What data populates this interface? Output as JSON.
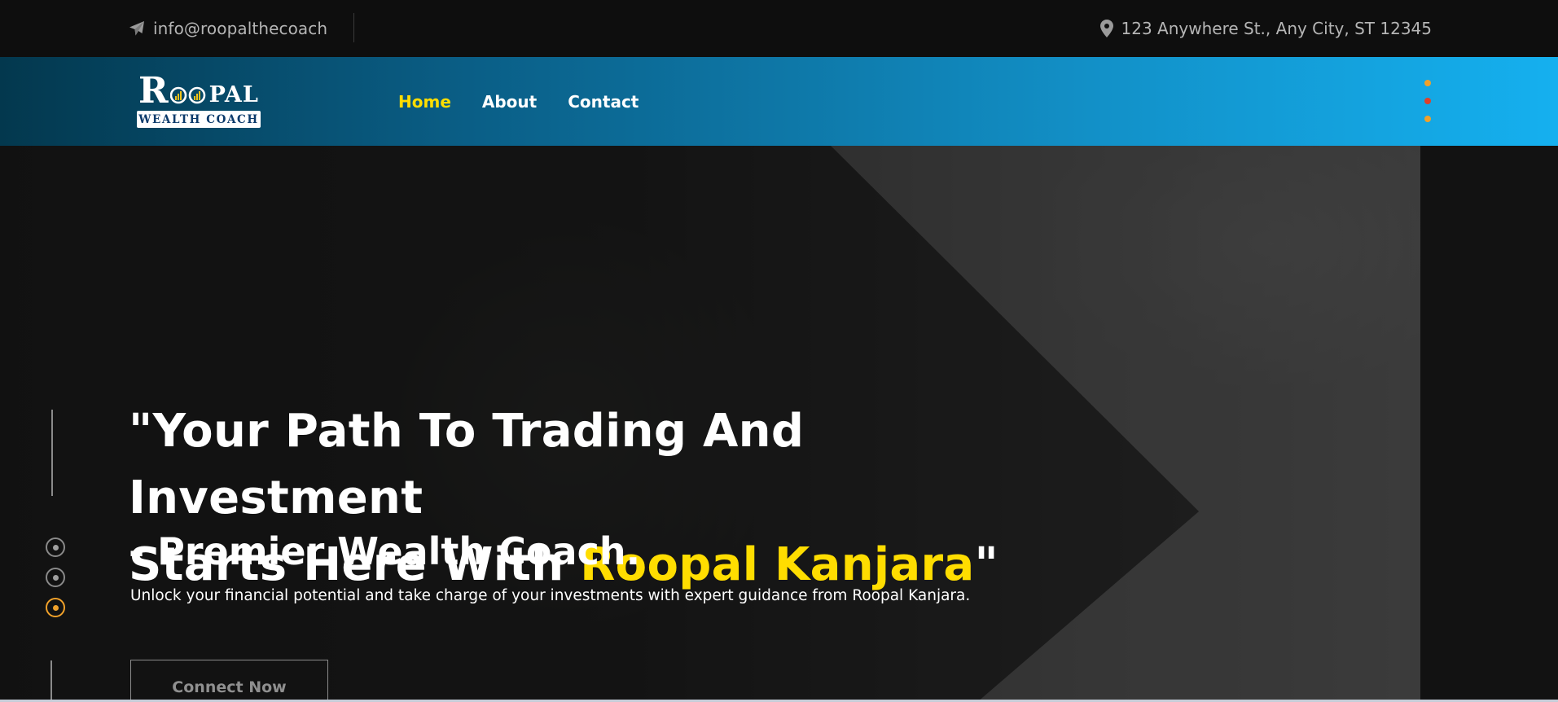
{
  "topbar": {
    "email": "info@roopalthecoach",
    "email_icon": "paper-plane-icon",
    "address": "123 Anywhere St., Any City, ST 12345",
    "address_icon": "map-pin-icon"
  },
  "logo": {
    "brand_first": "R",
    "brand_rest": "PAL",
    "tagline": "WEALTH COACH"
  },
  "nav": {
    "items": [
      {
        "label": "Home",
        "active": true
      },
      {
        "label": "About",
        "active": false
      },
      {
        "label": "Contact",
        "active": false
      }
    ],
    "menu_icon": "vertical-dots-menu-icon",
    "menu_dot_colors": [
      "#f0a12a",
      "#e0402a",
      "#f0a12a"
    ]
  },
  "hero": {
    "headline_part1": "\"Your Path To Trading And Investment",
    "headline_part2": "Starts Here With ",
    "headline_highlight": "Roopal Kanjara",
    "headline_end": "\"",
    "subheadline": "- Premier Wealth Coach.",
    "description": "Unlock your financial potential and take charge of your investments with expert guidance from Roopal Kanjara.",
    "cta_label": "Connect Now",
    "slides_total": 3,
    "active_slide": 3
  },
  "colors": {
    "accent_yellow": "#ffdd00",
    "accent_orange": "#f0a12a",
    "nav_gradient_start": "#03384e",
    "nav_gradient_end": "#15b0ef"
  }
}
